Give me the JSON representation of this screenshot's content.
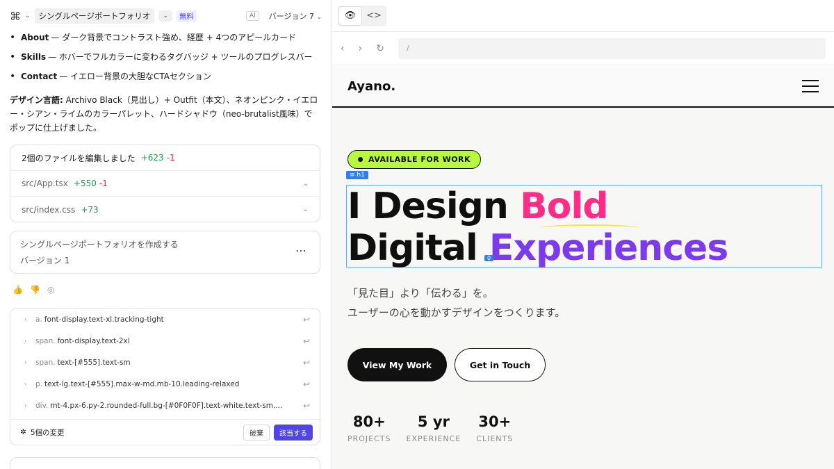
{
  "topbar": {
    "project_name": "シングルページポートフォリオ",
    "plan_badge": "無料",
    "ai_badge": "AI",
    "version": "バージョン 7"
  },
  "chat": {
    "bullets": [
      {
        "title": "About",
        "text": "— ダーク背景でコントラスト強め、経歴 + 4つのアピールカード"
      },
      {
        "title": "Skills",
        "text": "— ホバーでフルカラーに変わるタグバッジ + ツールのプログレスバー"
      },
      {
        "title": "Contact",
        "text": "— イエロー背景の大胆なCTAセクション"
      }
    ],
    "design_label": "デザイン言語:",
    "design_text": "Archivo Black（見出し）+ Outfit（本文）、ネオンピンク・イエロー・シアン・ライムのカラーパレット、ハードシャドウ（neo-brutalist風味）でポップに仕上げました。"
  },
  "files": {
    "header": "2個のファイルを編集しました",
    "header_plus": "+623",
    "header_minus": "-1",
    "items": [
      {
        "name": "src/App.tsx",
        "plus": "+550",
        "minus": "-1"
      },
      {
        "name": "src/index.css",
        "plus": "+73",
        "minus": ""
      }
    ]
  },
  "version_card": {
    "title": "シングルページポートフォリオを作成する",
    "subtitle": "バージョン 1"
  },
  "changes": {
    "rows": [
      {
        "tag": "a.",
        "text": "font-display.text-xl.tracking-tight"
      },
      {
        "tag": "span.",
        "text": "font-display.text-2xl"
      },
      {
        "tag": "span.",
        "text": "text-[#555].text-sm"
      },
      {
        "tag": "p.",
        "text": "text-lg.text-[#555].max-w-md.mb-10.leading-relaxed"
      },
      {
        "tag": "div.",
        "text": "mt-4.px-6.py-2.rounded-full.bg-[#0F0F0F].text-white.text-sm...."
      }
    ],
    "count_label": "5個の変更",
    "discard_label": "破棄",
    "apply_label": "該当する"
  },
  "preview": {
    "url": "/",
    "brand": "Ayano.",
    "badge": "AVAILABLE FOR WORK",
    "h1_tag": "h1",
    "zero_tag": "0",
    "headline_line1_a": "I Design ",
    "headline_line1_b": "Bold",
    "headline_line2_a": "Digital ",
    "headline_line2_b": "Experiences",
    "sub_line1": "「見た目」より「伝わる」を。",
    "sub_line2": "ユーザーの心を動かすデザインをつくります。",
    "cta_primary": "View My Work",
    "cta_secondary": "Get in Touch",
    "stats": [
      {
        "num": "80+",
        "label": "PROJECTS"
      },
      {
        "num": "5 yr",
        "label": "EXPERIENCE"
      },
      {
        "num": "30+",
        "label": "CLIENTS"
      }
    ]
  },
  "colors": {
    "accent": "#4f46e5",
    "pink": "#ff2d87",
    "purple": "#7c3aed",
    "lime": "#b8f93f"
  }
}
